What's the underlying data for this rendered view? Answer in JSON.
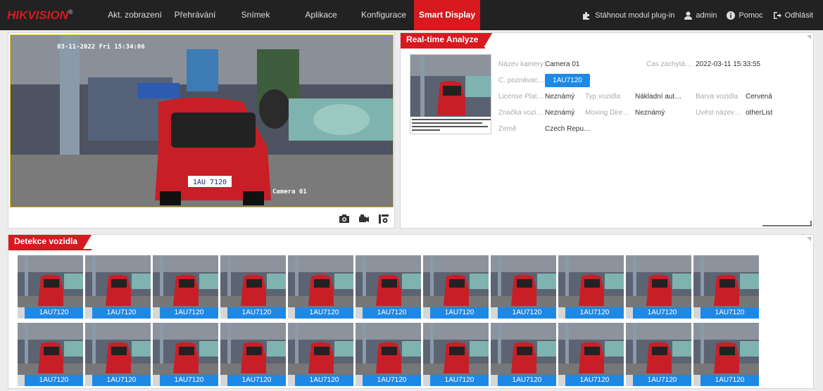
{
  "brand": {
    "logo_text": "HIKVISION",
    "reg_mark": "®"
  },
  "nav": {
    "items": [
      {
        "label": "Akt. zobrazení"
      },
      {
        "label": "Přehrávání"
      },
      {
        "label": "Snímek"
      },
      {
        "label": "Aplikace"
      },
      {
        "label": "Konfigurace"
      },
      {
        "label": "Smart Display"
      }
    ],
    "active_index": 5
  },
  "user_menu": {
    "plugin_label": "Stáhnout modul plug-in",
    "user_label": "admin",
    "help_label": "Pomoc",
    "logout_label": "Odhlásit"
  },
  "live_view": {
    "osd_time": "03-11-2022 Fri 15:34:06",
    "osd_camera": "Camera 01",
    "plate_on_car": "1AU 7120",
    "toolbar": {
      "icons": [
        "camera-icon",
        "record-icon",
        "settings-icon"
      ]
    }
  },
  "analyze": {
    "title": "Real-time Analyze",
    "fields": {
      "camera_name_label": "Název kamery",
      "camera_name_value": "Camera 01",
      "capture_time_label": "Čas zachytá…",
      "capture_time_value": "2022-03-11 15:33:55",
      "plate_label": "Č. poznávac…",
      "plate_value": "1AU7120",
      "license_label": "License Plat…",
      "license_value": "Neznámý",
      "vehicle_type_label": "Typ vozidla",
      "vehicle_type_value": "Nákladní aut…",
      "color_label": "Barva vozidla",
      "color_value": "Červená",
      "brand_label": "Značka vozi…",
      "brand_value": "Neznámý",
      "direction_label": "Moving Dire…",
      "direction_value": "Neznámý",
      "custom_label": "Uvést název…",
      "custom_value": "otherList",
      "country_label": "Země",
      "country_value": "Czech Repu…"
    }
  },
  "detection": {
    "title": "Detekce vozidla",
    "rows": [
      [
        "1AU7120",
        "1AU7120",
        "1AU7120",
        "1AU7120",
        "1AU7120",
        "1AU7120",
        "1AU7120",
        "1AU7120",
        "1AU7120",
        "1AU7120",
        "1AU7120"
      ],
      [
        "1AU7120",
        "1AU7120",
        "1AU7120",
        "1AU7120",
        "1AU7120",
        "1AU7120",
        "1AU7120",
        "1AU7120",
        "1AU7120",
        "1AU7120",
        "1AU7120"
      ]
    ]
  },
  "colors": {
    "accent": "#d71920",
    "plate_blue": "#1e88e5",
    "topbar": "#222222"
  }
}
